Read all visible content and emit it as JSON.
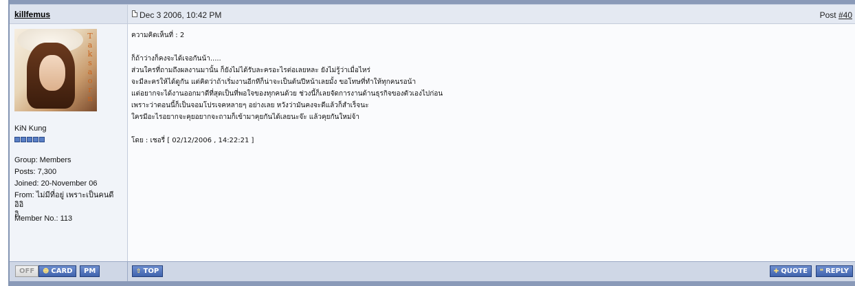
{
  "post": {
    "username": "killfemus",
    "date": "Dec 3 2006, 10:42 PM",
    "post_label": "Post ",
    "post_number": "#40"
  },
  "author": {
    "avatar_letters": [
      "T",
      "a",
      "k",
      "s",
      "a",
      "o",
      "r",
      "n"
    ],
    "display_name": "KiN Kung",
    "pips": 5,
    "group": "Group: Members",
    "posts": "Posts: 7,300",
    "joined": "Joined: 20-November 06",
    "from_line1": "From: ไม่มีที่อยู่ เพราะเป็นคนดี อิอิ",
    "from_line2": "อิ",
    "member_no": "Member No.: 113"
  },
  "body": {
    "lines": [
      "ความคิดเห็นที่ : 2",
      "",
      "ก็ถ้าว่างก็คงจะได้เจอกันน้า.....",
      "ส่วนใครที่ถามถึงผลงานมานั้น ก็ยังไม่ได้รับละครอะไรต่อเลยหละ ยังไม่รู้ว่าเมื่อไหร่",
      "จะมีละครให้ได้ดูกัน แต่คิดว่าถ้าเริ่มงานอีกทีก็น่าจะเป็นต้นปีหน้าเลยมั้ง ขอโทษที่ทำให้ทุกคนรอน้า",
      "แต่อยากจะได้งานออกมาดีที่สุดเป็นที่พอใจของทุกคนด้วย ช่วงนี้ก็เลยจัดการงานด้านธุรกิจของตัวเองไปก่อน",
      "เพราะว่าตอนนี้ก็เป็นจอมโปรเจคหลายๆ อย่างเลย หวังว่ามันคงจะดีแล้วก็สำเร็จนะ",
      "ใครมีอะไรอยากจะคุยอยากจะถามก็เข้ามาคุยกันได้เลยนะจ๊ะ แล้วคุยกันใหม่จ้า",
      "",
      "โดย : เชอรี่ [ 02/12/2006 , 14:22:21 ]"
    ]
  },
  "buttons": {
    "off": "OFF",
    "card": "CARD",
    "pm": "PM",
    "top": "TOP",
    "quote": "QUOTE",
    "reply": "REPLY"
  }
}
